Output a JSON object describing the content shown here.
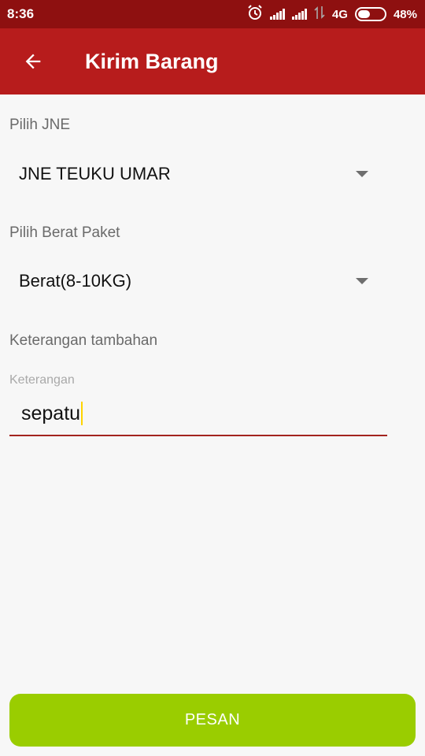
{
  "status_bar": {
    "time": "8:36",
    "network": "4G",
    "battery": "48%",
    "battery_level": 0.48,
    "icons": [
      "alarm-icon",
      "signal-icon",
      "signal-icon",
      "data-arrows-icon",
      "battery-icon"
    ]
  },
  "app_bar": {
    "title": "Kirim Barang",
    "back_icon": "arrow-left-icon"
  },
  "form": {
    "jne_label": "Pilih JNE",
    "jne_selected": "JNE TEUKU UMAR",
    "weight_label": "Pilih Berat Paket",
    "weight_selected": "Berat(8-10KG)",
    "notes_label": "Keterangan tambahan",
    "notes_hint": "Keterangan",
    "notes_value": "sepatu"
  },
  "actions": {
    "submit_label": "PESAN"
  },
  "colors": {
    "status_bar": "#8e1010",
    "app_bar": "#b71c1c",
    "accent": "#a3241f",
    "button": "#9acd00",
    "cursor": "#ffd400"
  }
}
